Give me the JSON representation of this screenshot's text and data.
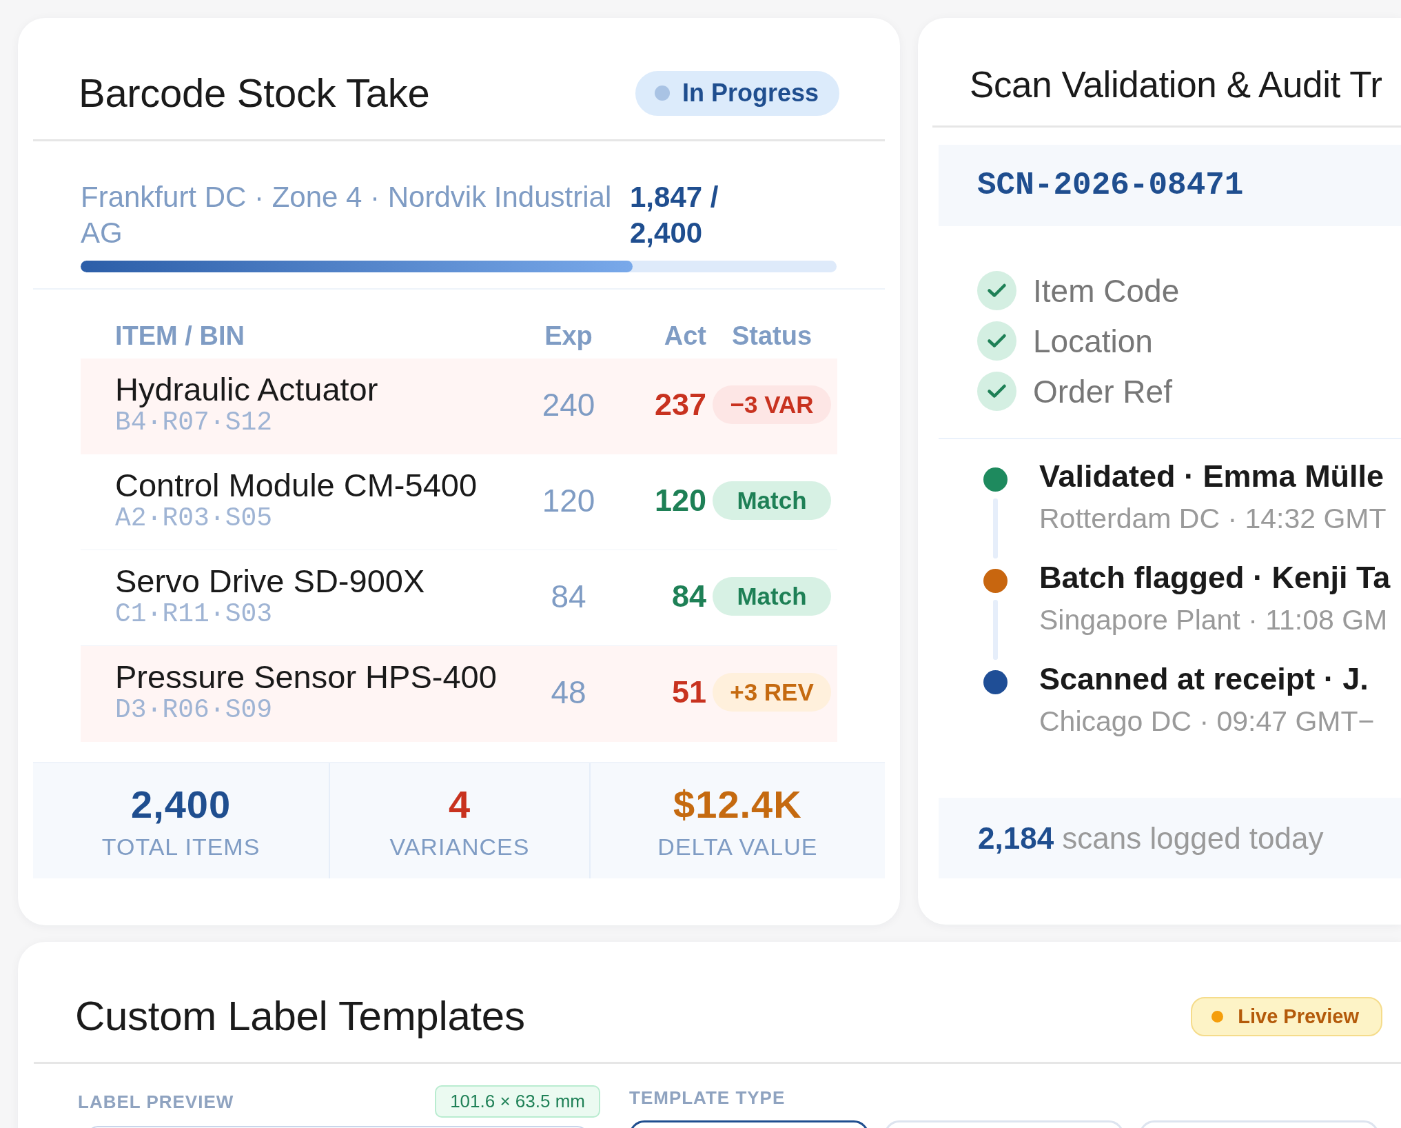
{
  "stock_take": {
    "title": "Barcode Stock Take",
    "status_badge": {
      "label": "In Progress",
      "kind": "info"
    },
    "location": "Frankfurt DC · Zone 4 · Nordvik Industrial AG",
    "count": "1,847 / 2,400",
    "progress": {
      "level": 0.73
    },
    "table": {
      "columns": [
        "ITEM / BIN",
        "Exp",
        "Act",
        "Status"
      ],
      "rows": [
        {
          "item": "Hydraulic Actuator",
          "bin": "B4·R07·S12",
          "expected": "240",
          "actual": "237",
          "flagged": true,
          "status": {
            "label": "−3 VAR",
            "kind": "variance"
          }
        },
        {
          "item": "Control Module CM-5400",
          "bin": "A2·R03·S05",
          "expected": "120",
          "actual": "120",
          "flagged": false,
          "status": {
            "label": "Match",
            "kind": "match"
          }
        },
        {
          "item": "Servo Drive SD-900X",
          "bin": "C1·R11·S03",
          "expected": "84",
          "actual": "84",
          "flagged": false,
          "status": {
            "label": "Match",
            "kind": "match"
          }
        },
        {
          "item": "Pressure Sensor HPS-400",
          "bin": "D3·R06·S09",
          "expected": "48",
          "actual": "51",
          "flagged": true,
          "status": {
            "label": "+3 REV",
            "kind": "review"
          }
        }
      ]
    },
    "summary": [
      {
        "value": "2,400",
        "label": "TOTAL ITEMS",
        "color": "#1f4e8f"
      },
      {
        "value": "4",
        "label": "VARIANCES",
        "color": "#c8321f"
      },
      {
        "value": "$12.4K",
        "label": "DELTA VALUE",
        "color": "#c56a10"
      }
    ]
  },
  "scan_validation": {
    "title": "Scan Validation & Audit Tr",
    "scan_id": "SCN-2026-08471",
    "checks": [
      {
        "label": "Item Code",
        "checked": true
      },
      {
        "label": "Location",
        "checked": true
      },
      {
        "label": "Order Ref",
        "checked": true
      }
    ],
    "audit_trail": [
      {
        "title": "Validated · Emma Mülle",
        "detail": "Rotterdam DC · 14:32 GMT",
        "color": "#1e8a5e"
      },
      {
        "title": "Batch flagged · Kenji Ta",
        "detail": "Singapore Plant · 11:08 GM",
        "color": "#c8660f"
      },
      {
        "title": "Scanned at receipt · J.",
        "detail": "Chicago DC · 09:47 GMT−",
        "color": "#1f4e96"
      }
    ],
    "footer": "**2,184** scans logged today"
  },
  "label_templates": {
    "title": "Custom Label Templates",
    "status_badge": {
      "label": "Live Preview",
      "kind": "warning"
    },
    "preview": {
      "heading": "LABEL PREVIEW",
      "size": "101.6 × 63.5 mm"
    },
    "template_type": {
      "heading": "TEMPLATE TYPE",
      "options": [
        {
          "selected": true
        },
        {
          "selected": false
        },
        {
          "selected": false
        }
      ]
    }
  }
}
